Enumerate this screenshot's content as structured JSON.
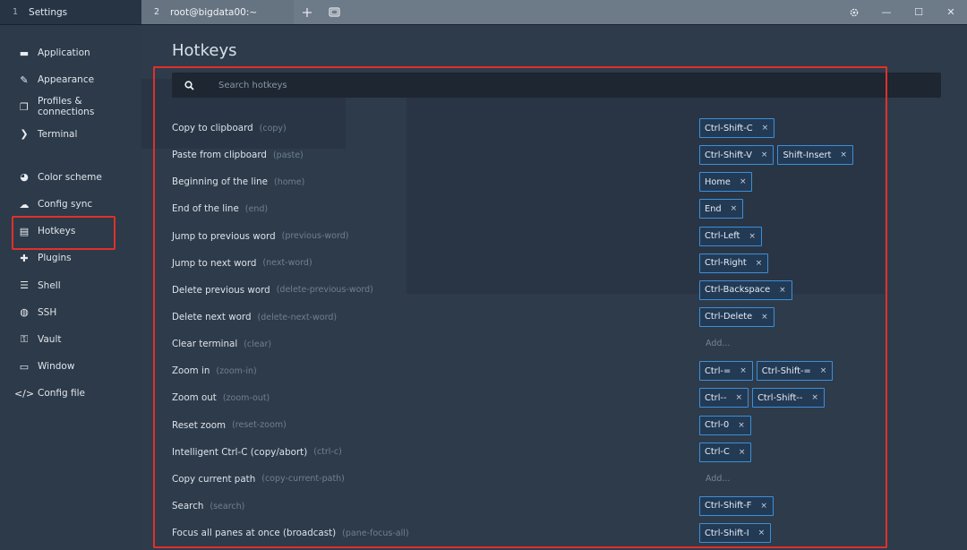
{
  "tabs": [
    {
      "num": "1",
      "title": "Settings"
    },
    {
      "num": "2",
      "title": "root@bigdata00:~"
    }
  ],
  "toolbar": {
    "new_tab_icon": "plus-icon",
    "split_icon": "window-icon",
    "gear_icon": "gear-icon"
  },
  "window_controls": {
    "minimize": "—",
    "maximize": "☐",
    "close": "✕"
  },
  "sidebar": {
    "group1": [
      {
        "label": "Application",
        "icon": "monitor-icon",
        "glyph": "▬"
      },
      {
        "label": "Appearance",
        "icon": "brush-icon",
        "glyph": "✎"
      },
      {
        "label": "Profiles & connections",
        "icon": "profiles-icon",
        "glyph": "❐"
      },
      {
        "label": "Terminal",
        "icon": "terminal-icon",
        "glyph": "❯"
      }
    ],
    "group2": [
      {
        "label": "Color scheme",
        "icon": "palette-icon",
        "glyph": "◕"
      },
      {
        "label": "Config sync",
        "icon": "cloud-icon",
        "glyph": "☁"
      },
      {
        "label": "Hotkeys",
        "icon": "keyboard-icon",
        "glyph": "▤",
        "selected": true
      },
      {
        "label": "Plugins",
        "icon": "puzzle-icon",
        "glyph": "✚"
      },
      {
        "label": "Shell",
        "icon": "list-icon",
        "glyph": "☰"
      },
      {
        "label": "SSH",
        "icon": "globe-icon",
        "glyph": "◍"
      },
      {
        "label": "Vault",
        "icon": "key-icon",
        "glyph": "⚿"
      },
      {
        "label": "Window",
        "icon": "window-icon",
        "glyph": "▭"
      },
      {
        "label": "Config file",
        "icon": "code-icon",
        "glyph": "</>"
      }
    ]
  },
  "page": {
    "title": "Hotkeys",
    "search_placeholder": "Search hotkeys",
    "add_label": "Add..."
  },
  "hotkeys": [
    {
      "label": "Copy to clipboard",
      "id": "(copy)",
      "keys": [
        "Ctrl-Shift-C"
      ]
    },
    {
      "label": "Paste from clipboard",
      "id": "(paste)",
      "keys": [
        "Ctrl-Shift-V",
        "Shift-Insert"
      ]
    },
    {
      "label": "Beginning of the line",
      "id": "(home)",
      "keys": [
        "Home"
      ]
    },
    {
      "label": "End of the line",
      "id": "(end)",
      "keys": [
        "End"
      ]
    },
    {
      "label": "Jump to previous word",
      "id": "(previous-word)",
      "keys": [
        "Ctrl-Left"
      ]
    },
    {
      "label": "Jump to next word",
      "id": "(next-word)",
      "keys": [
        "Ctrl-Right"
      ]
    },
    {
      "label": "Delete previous word",
      "id": "(delete-previous-word)",
      "keys": [
        "Ctrl-Backspace"
      ]
    },
    {
      "label": "Delete next word",
      "id": "(delete-next-word)",
      "keys": [
        "Ctrl-Delete"
      ]
    },
    {
      "label": "Clear terminal",
      "id": "(clear)",
      "keys": []
    },
    {
      "label": "Zoom in",
      "id": "(zoom-in)",
      "keys": [
        "Ctrl-=",
        "Ctrl-Shift-="
      ]
    },
    {
      "label": "Zoom out",
      "id": "(zoom-out)",
      "keys": [
        "Ctrl--",
        "Ctrl-Shift--"
      ]
    },
    {
      "label": "Reset zoom",
      "id": "(reset-zoom)",
      "keys": [
        "Ctrl-0"
      ]
    },
    {
      "label": "Intelligent Ctrl-C (copy/abort)",
      "id": "(ctrl-c)",
      "keys": [
        "Ctrl-C"
      ]
    },
    {
      "label": "Copy current path",
      "id": "(copy-current-path)",
      "keys": []
    },
    {
      "label": "Search",
      "id": "(search)",
      "keys": [
        "Ctrl-Shift-F"
      ]
    },
    {
      "label": "Focus all panes at once (broadcast)",
      "id": "(pane-focus-all)",
      "keys": [
        "Ctrl-Shift-I"
      ]
    }
  ]
}
